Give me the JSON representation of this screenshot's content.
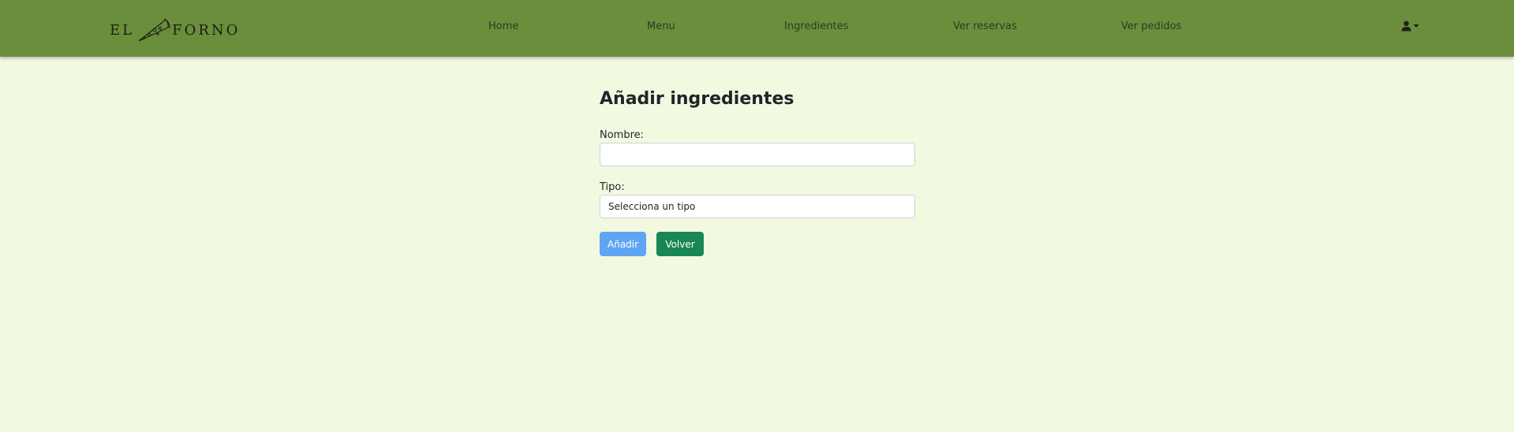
{
  "header": {
    "logo_left": "EL",
    "logo_right": "FORNO",
    "nav": [
      {
        "label": "Home"
      },
      {
        "label": "Menu"
      },
      {
        "label": "Ingredientes"
      },
      {
        "label": "Ver reservas"
      },
      {
        "label": "Ver pedidos"
      }
    ],
    "user_icon": "user-icon",
    "dropdown_icon": "caret-down-icon"
  },
  "form": {
    "title": "Añadir ingredientes",
    "name_label": "Nombre:",
    "name_value": "",
    "type_label": "Tipo:",
    "type_selected": "Selecciona un tipo",
    "add_button": "Añadir",
    "back_button": "Volver"
  },
  "colors": {
    "navbar": "#6a8e3c",
    "background": "#f1f9e0",
    "primary_button": "#5fa5f4",
    "success_button": "#198754"
  }
}
